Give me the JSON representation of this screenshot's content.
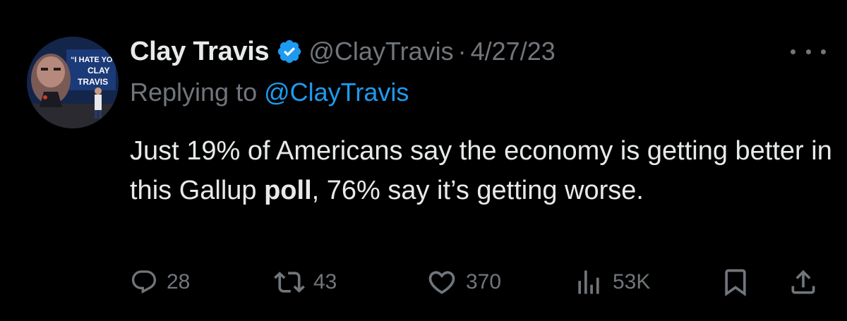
{
  "tweet": {
    "author_name": "Clay Travis",
    "handle": "@ClayTravis",
    "separator": "·",
    "date": "4/27/23",
    "replying_prefix": "Replying to ",
    "replying_to": "@ClayTravis",
    "text_part1": "Just 19% of Americans say the economy is getting better in this Gallup ",
    "text_bold": "poll",
    "text_part2": ", 76% say it’s getting worse."
  },
  "avatar": {
    "sign_line1": "“I HATE YOU",
    "sign_line2": "CLAY",
    "sign_line3": "TRAVIS"
  },
  "actions": {
    "replies": "28",
    "reposts": "43",
    "likes": "370",
    "views": "53K"
  },
  "colors": {
    "background": "#000000",
    "primary_text": "#e7e9ea",
    "secondary_text": "#71767b",
    "link": "#1d9bf0",
    "verified_badge": "#1d9bf0"
  },
  "icons": [
    "verified-badge-icon",
    "more-icon",
    "reply-icon",
    "repost-icon",
    "like-icon",
    "views-icon",
    "bookmark-icon",
    "share-icon"
  ]
}
